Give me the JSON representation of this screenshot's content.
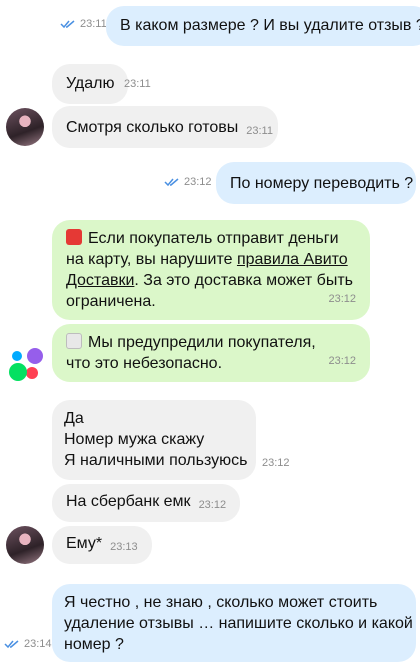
{
  "messages": {
    "m1": {
      "text": "В каком размере ? И вы удалите отзыв ?",
      "time": "23:11"
    },
    "m2": {
      "text": "Удалю",
      "time": "23:11"
    },
    "m3": {
      "text": "Смотря сколько готовы",
      "time": "23:11"
    },
    "m4": {
      "text": "По номеру переводить ?",
      "time": "23:12"
    },
    "m5": {
      "line1": "Если покупатель отправит деньги",
      "line2_a": "на карту, вы нарушите ",
      "line2_link": "правила Авито",
      "line3_link": "Доставки",
      "line3_b": ". За это доставка может быть",
      "line4": "ограничена.",
      "time": "23:12"
    },
    "m6": {
      "line1": "Мы предупредили покупателя,",
      "line2": "что это небезопасно.",
      "time": "23:12"
    },
    "m7": {
      "line1": "Да",
      "line2": "Номер мужа скажу",
      "line3": "Я наличными пользуюсь",
      "time": "23:12"
    },
    "m8": {
      "text": "На сбербанк емк",
      "time": "23:12"
    },
    "m9": {
      "text": "Ему*",
      "time": "23:13"
    },
    "m10": {
      "line1": "Я честно , не знаю , сколько может стоить",
      "line2": "удаление отзывы … напишите сколько и какой",
      "line3": "номер ?",
      "time": "23:14"
    }
  },
  "colors": {
    "incoming": "#f0f0f0",
    "outgoing": "#dceefe",
    "system": "#dbf7c9"
  },
  "icons": {
    "read_receipt": "double-check-icon",
    "system_warning": "siren-emoji",
    "system_notice": "envelope-emoji",
    "avito_logo": "avito-logo"
  }
}
